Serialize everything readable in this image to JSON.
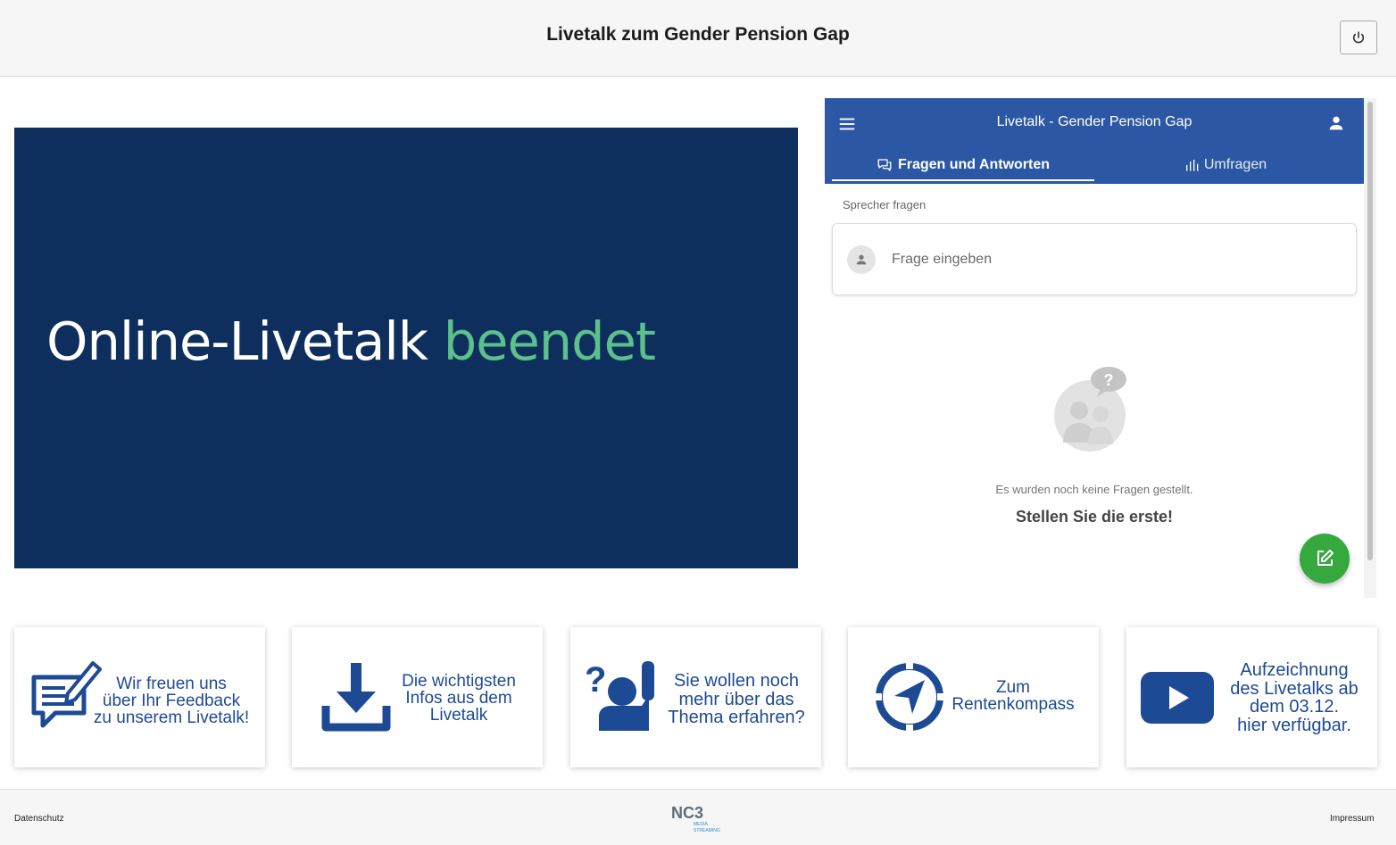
{
  "header": {
    "title": "Livetalk zum Gender Pension Gap",
    "power_icon": "power-icon"
  },
  "stage": {
    "text_main": "Online-Livetalk ",
    "text_accent": "beendet",
    "background": "#0e2f5d",
    "accent_color": "#5cc08c"
  },
  "panel": {
    "app_title": "Livetalk - Gender Pension Gap",
    "tabs": [
      {
        "label": "Fragen und Antworten",
        "icon": "chat-bubbles-icon",
        "active": true
      },
      {
        "label": "Umfragen",
        "icon": "bar-chart-icon",
        "active": false
      }
    ],
    "ask_label": "Sprecher fragen",
    "ask_placeholder": "Frage eingeben",
    "empty_text": "Es wurden noch keine Fragen gestellt.",
    "empty_cta": "Stellen Sie die erste!",
    "accent": "#2b57a4",
    "fab_color": "#35a83e"
  },
  "tiles": [
    {
      "lines": [
        "Wir freuen uns",
        "über Ihr Feedback",
        "zu unserem Livetalk!"
      ],
      "icon": "feedback-icon"
    },
    {
      "lines": [
        "Die wichtigsten",
        "Infos aus dem",
        "Livetalk"
      ],
      "icon": "download-icon"
    },
    {
      "lines": [
        "Sie wollen noch",
        "mehr über das",
        "Thema erfahren?"
      ],
      "icon": "question-person-icon"
    },
    {
      "lines": [
        "Zum",
        "Rentenkompass"
      ],
      "icon": "compass-icon"
    },
    {
      "lines": [
        "Aufzeichnung",
        "des Livetalks ab",
        "dem 03.12.",
        "hier verfügbar."
      ],
      "icon": "play-video-icon"
    }
  ],
  "footer": {
    "privacy": "Datenschutz",
    "imprint": "Impressum",
    "logo_text": "NC3",
    "logo_sub_1": "MEDIA",
    "logo_sub_2": "STREAMING"
  }
}
